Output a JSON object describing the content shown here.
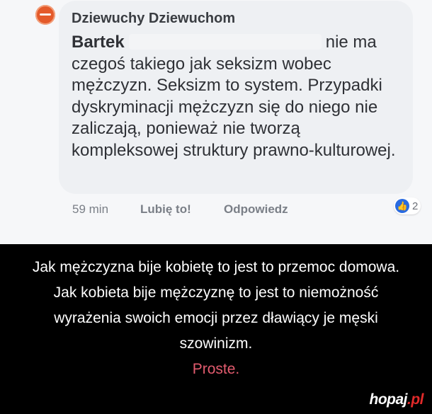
{
  "post": {
    "author": "Dziewuchy Dziewuchom",
    "mention_name": "Bartek",
    "text_after_mention": "nie ma czegoś takiego jak seksizm wobec mężczyzn. Seksizm to system. Przypadki dyskryminacji mężczyzn się do niego nie zaliczają, ponieważ nie tworzą kompleksowej struktury prawno-kulturowej."
  },
  "actions": {
    "time": "59 min",
    "like": "Lubię to!",
    "reply": "Odpowiedz",
    "reaction_count": "2"
  },
  "caption": {
    "line1": "Jak mężczyzna bije kobietę to jest to przemoc domowa.",
    "line2": "Jak kobieta bije mężczyznę to jest to niemożność",
    "line3": "wyrażenia swoich emocji przez dławiący je męski",
    "line4": "szowinizm.",
    "line5": "Proste."
  },
  "logo": {
    "main": "hopaj",
    "dot": ".pl"
  },
  "colors": {
    "accent": "#e25b6e",
    "like_blue": "#2a6be0"
  }
}
